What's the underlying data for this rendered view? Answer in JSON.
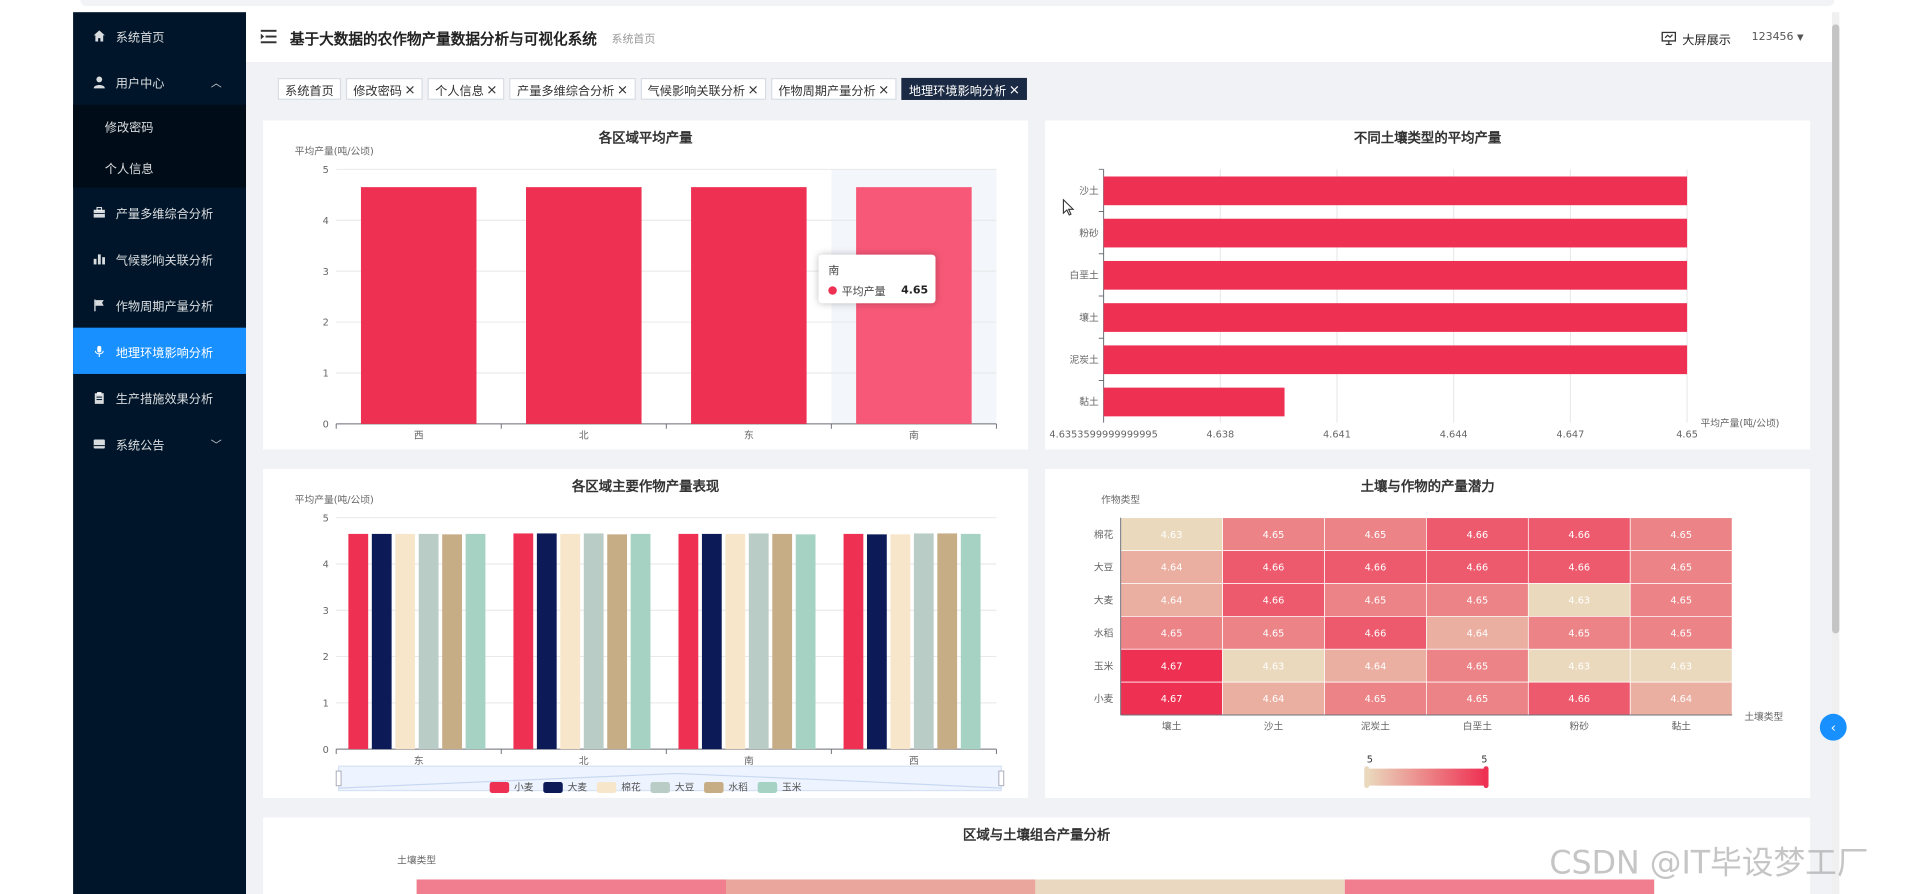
{
  "sidebar": {
    "items": [
      {
        "label": "系统首页",
        "icon": "home-icon"
      },
      {
        "label": "用户中心",
        "icon": "user-icon"
      },
      {
        "label": "产量多维综合分析",
        "icon": "briefcase-icon"
      },
      {
        "label": "气候影响关联分析",
        "icon": "bar-chart-icon"
      },
      {
        "label": "作物周期产量分析",
        "icon": "flag-icon"
      },
      {
        "label": "地理环境影响分析",
        "icon": "microphone-icon"
      },
      {
        "label": "生产措施效果分析",
        "icon": "clipboard-icon"
      },
      {
        "label": "系统公告",
        "icon": "drive-icon"
      }
    ],
    "submenu": [
      {
        "label": "修改密码"
      },
      {
        "label": "个人信息"
      }
    ],
    "active_index": 5
  },
  "header": {
    "title": "基于大数据的农作物产量数据分析与可视化系统",
    "breadcrumb": "系统首页",
    "big_screen": "大屏展示",
    "user": "123456"
  },
  "tags": [
    {
      "label": "系统首页",
      "closable": false
    },
    {
      "label": "修改密码",
      "closable": true
    },
    {
      "label": "个人信息",
      "closable": true
    },
    {
      "label": "产量多维综合分析",
      "closable": true
    },
    {
      "label": "气候影响关联分析",
      "closable": true
    },
    {
      "label": "作物周期产量分析",
      "closable": true
    },
    {
      "label": "地理环境影响分析",
      "closable": true,
      "active": true
    }
  ],
  "colors": {
    "accent": "#1890ff",
    "sidebar_bg": "#001529",
    "bar_red": "#ee3052",
    "bar_highlight": "#f85878"
  },
  "chart_data": [
    {
      "type": "bar",
      "title": "各区域平均产量",
      "ylabel": "平均产量(吨/公顷)",
      "categories": [
        "西",
        "北",
        "东",
        "南"
      ],
      "values": [
        4.65,
        4.65,
        4.65,
        4.65
      ],
      "ylim": [
        0,
        5
      ],
      "yticks": [
        "0",
        "1",
        "2",
        "3",
        "4",
        "5"
      ],
      "tooltip": {
        "category": "南",
        "series": "平均产量",
        "value": "4.65"
      }
    },
    {
      "type": "bar",
      "orientation": "horizontal",
      "title": "不同土壤类型的平均产量",
      "xlabel": "平均产量(吨/公顷)",
      "categories": [
        "沙土",
        "粉砂",
        "白垩土",
        "壤土",
        "泥炭土",
        "黏土"
      ],
      "values": [
        4.65,
        4.65,
        4.65,
        4.65,
        4.65,
        4.6399
      ],
      "xlim": [
        4.6353599999999995,
        4.65
      ],
      "xticks": [
        "4.6353599999999995",
        "4.638",
        "4.641",
        "4.644",
        "4.647",
        "4.65"
      ]
    },
    {
      "type": "bar",
      "title": "各区域主要作物产量表现",
      "ylabel": "平均产量(吨/公顷)",
      "categories": [
        "东",
        "北",
        "南",
        "西"
      ],
      "ylim": [
        0,
        5
      ],
      "yticks": [
        "0",
        "1",
        "2",
        "3",
        "4",
        "5"
      ],
      "series": [
        {
          "name": "小麦",
          "color": "#ee3052",
          "values": [
            4.65,
            4.66,
            4.65,
            4.65
          ]
        },
        {
          "name": "大麦",
          "color": "#0c1b58",
          "values": [
            4.65,
            4.66,
            4.65,
            4.64
          ]
        },
        {
          "name": "棉花",
          "color": "#f7e6c9",
          "values": [
            4.65,
            4.65,
            4.65,
            4.64
          ]
        },
        {
          "name": "大豆",
          "color": "#b9ccc6",
          "values": [
            4.65,
            4.66,
            4.66,
            4.66
          ]
        },
        {
          "name": "水稻",
          "color": "#c7ad85",
          "values": [
            4.64,
            4.64,
            4.65,
            4.66
          ]
        },
        {
          "name": "玉米",
          "color": "#a5d2c2",
          "values": [
            4.65,
            4.65,
            4.64,
            4.65
          ]
        }
      ]
    },
    {
      "type": "heatmap",
      "title": "土壤与作物的产量潜力",
      "ylabel": "作物类型",
      "xlabel": "土壤类型",
      "x": [
        "壤土",
        "沙土",
        "泥炭土",
        "白垩土",
        "粉砂",
        "黏土"
      ],
      "y": [
        "棉花",
        "大豆",
        "大麦",
        "水稻",
        "玉米",
        "小麦"
      ],
      "values": [
        [
          4.63,
          4.65,
          4.65,
          4.66,
          4.66,
          4.65
        ],
        [
          4.64,
          4.66,
          4.66,
          4.66,
          4.66,
          4.65
        ],
        [
          4.64,
          4.66,
          4.65,
          4.65,
          4.63,
          4.65
        ],
        [
          4.65,
          4.65,
          4.66,
          4.64,
          4.65,
          4.65
        ],
        [
          4.67,
          4.63,
          4.64,
          4.65,
          4.63,
          4.63
        ],
        [
          4.67,
          4.64,
          4.65,
          4.65,
          4.66,
          4.64
        ]
      ],
      "visual_map": {
        "min_label": "5",
        "max_label": "5"
      }
    },
    {
      "type": "heatmap",
      "title": "区域与土壤组合产量分析",
      "ylabel": "土壤类型"
    }
  ],
  "watermark": "CSDN @IT毕设梦工厂"
}
